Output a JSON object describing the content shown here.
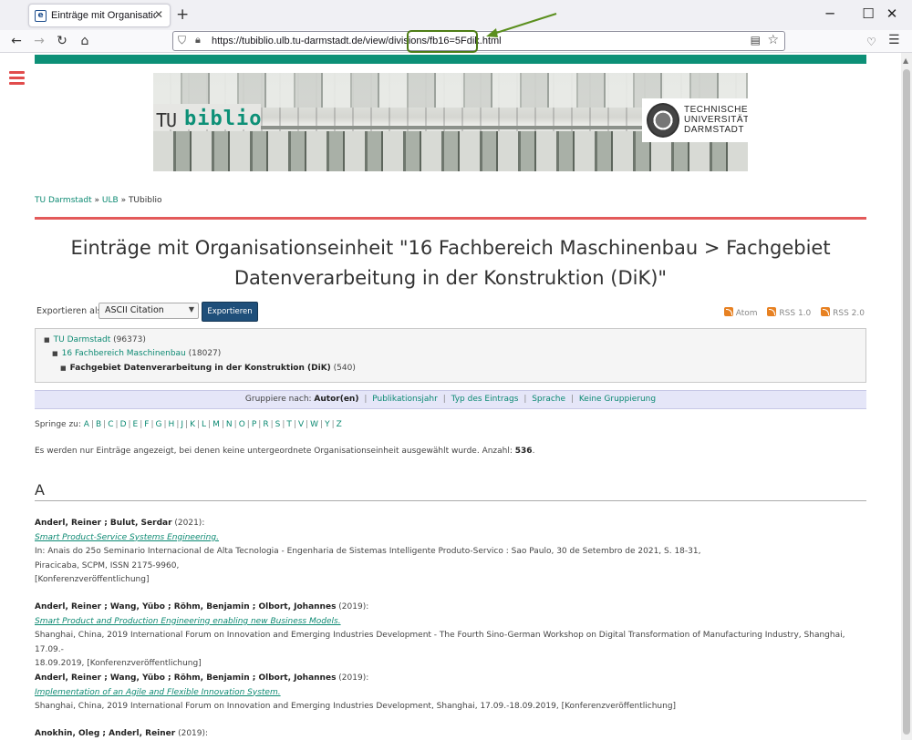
{
  "browser": {
    "tab_title": "Einträge mit Organisationseinheit",
    "tab_favicon": "e",
    "new_tab": "+",
    "url": "https://tubiblio.ulb.tu-darmstadt.de/view/divisions/fb16=5Fdik.html",
    "win_min": "─",
    "win_max": "☐",
    "win_close": "✕"
  },
  "banner": {
    "logo_tu": "TU",
    "logo_biblio": "biblio",
    "uni_line1": "TECHNISCHE",
    "uni_line2": "UNIVERSITÄT",
    "uni_line3": "DARMSTADT"
  },
  "breadcrumb": {
    "item1": "TU Darmstadt",
    "sep": " » ",
    "item2": "ULB",
    "item3": "TUbiblio"
  },
  "page": {
    "title": "Einträge mit Organisationseinheit \"16 Fachbereich Maschinenbau > Fachgebiet Datenverarbeitung in der Konstruktion (DiK)\""
  },
  "export": {
    "label": "Exportieren als",
    "selected_format": "ASCII Citation",
    "button": "Exportieren"
  },
  "feeds": {
    "atom": "Atom",
    "rss1": "RSS 1.0",
    "rss2": "RSS 2.0"
  },
  "tree": {
    "level1_name": "TU Darmstadt",
    "level1_count": " (96373)",
    "level2_name": "16 Fachbereich Maschinenbau",
    "level2_count": " (18027)",
    "level3_name": "Fachgebiet Datenverarbeitung in der Konstruktion (DiK)",
    "level3_count": " (540)"
  },
  "grouping": {
    "label": "Gruppiere nach: ",
    "current": "Autor(en)",
    "options": [
      "Publikationsjahr",
      "Typ des Eintrags",
      "Sprache",
      "Keine Gruppierung"
    ]
  },
  "jumpto": {
    "label": "Springe zu: ",
    "letters": [
      "A",
      "B",
      "C",
      "D",
      "E",
      "F",
      "G",
      "H",
      "J",
      "K",
      "L",
      "M",
      "N",
      "O",
      "P",
      "R",
      "S",
      "T",
      "V",
      "W",
      "Y",
      "Z"
    ]
  },
  "notice": {
    "text": "Es werden nur Einträge angezeigt, bei denen keine untergeordnete Organisationseinheit ausgewählt wurde. Anzahl: ",
    "count": "536",
    "end": "."
  },
  "section_letter": "A",
  "entries": [
    {
      "authors": "Anderl, Reiner ; Bulut, Serdar",
      "year": " (2021):",
      "title": "Smart Product-Service Systems Engineering.",
      "line1": "In: Anais do 25o Seminario Internacional de Alta Tecnologia - Engenharia de Sistemas Intelligente Produto-Servico : Sao Paulo, 30 de Setembro de 2021, S. 18-31,",
      "line2": "Piracicaba, SCPM, ISSN 2175-9960,",
      "line3": "[Konferenzveröffentlichung]"
    },
    {
      "authors": "Anderl, Reiner ; Wang, Yübo ; Röhm, Benjamin ; Olbort, Johannes",
      "year": " (2019):",
      "title": "Smart Product and Production Engineering enabling new Business Models.",
      "line1": "Shanghai, China, 2019 International Forum on Innovation and Emerging Industries Development - The Fourth Sino-German Workshop on Digital Transformation of Manufacturing Industry, Shanghai, 17.09.-",
      "line2": "18.09.2019, [Konferenzveröffentlichung]",
      "line3": ""
    },
    {
      "authors": "Anderl, Reiner ; Wang, Yübo ; Röhm, Benjamin ; Olbort, Johannes",
      "year": " (2019):",
      "title": "Implementation of an Agile and Flexible Innovation System.",
      "line1": "Shanghai, China, 2019 International Forum on Innovation and Emerging Industries Development, Shanghai, 17.09.-18.09.2019, [Konferenzveröffentlichung]",
      "line2": "",
      "line3": ""
    },
    {
      "authors": "Anokhin, Oleg ; Anderl, Reiner",
      "year": " (2019):",
      "title": "",
      "line1": "",
      "line2": "",
      "line3": ""
    }
  ]
}
